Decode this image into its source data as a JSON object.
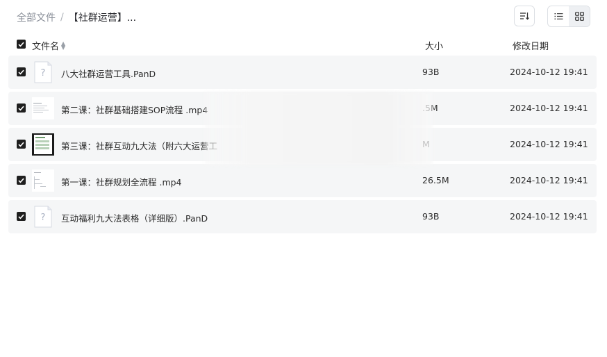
{
  "breadcrumb": {
    "root": "全部文件",
    "separator": "/",
    "current": "【社群运营】..."
  },
  "toolbar": {
    "sort_icon": "sort-icon",
    "list_view_icon": "list-view-icon",
    "grid_view_icon": "grid-view-icon"
  },
  "columns": {
    "name": "文件名",
    "size": "大小",
    "date": "修改日期"
  },
  "files": [
    {
      "name": "八大社群运营工具.PanD",
      "size": "93B",
      "date": "2024-10-12 19:41",
      "icon": "unknown-file-icon",
      "checked": true
    },
    {
      "name": "第二课：社群基础搭建SOP流程 .mp4",
      "size": ".5M",
      "date": "2024-10-12 19:41",
      "icon": "video-thumbnail",
      "checked": true
    },
    {
      "name": "第三课：社群互动九大法（附六大运营工",
      "size": "M",
      "date": "2024-10-12 19:41",
      "icon": "video-thumbnail",
      "checked": true
    },
    {
      "name": "第一课：社群规划全流程 .mp4",
      "size": "26.5M",
      "date": "2024-10-12 19:41",
      "icon": "video-thumbnail",
      "checked": true
    },
    {
      "name": "互动福利九大法表格（详细版）.PanD",
      "size": "93B",
      "date": "2024-10-12 19:41",
      "icon": "unknown-file-icon",
      "checked": true
    }
  ]
}
